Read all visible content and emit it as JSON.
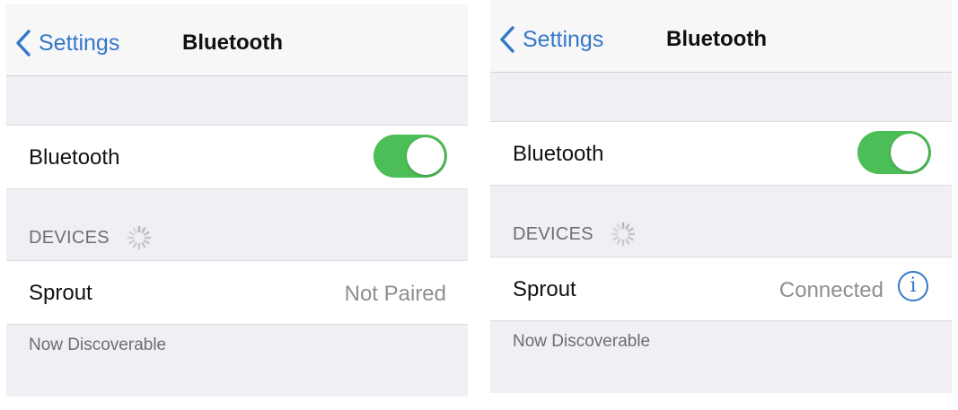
{
  "colors": {
    "accent": "#3478c9",
    "toggle_on": "#4cbe58",
    "background": "#efeff4"
  },
  "panels": [
    {
      "navbar": {
        "back_label": "Settings",
        "title": "Bluetooth"
      },
      "bluetooth": {
        "label": "Bluetooth",
        "enabled": true
      },
      "devices_header": "DEVICES",
      "device": {
        "name": "Sprout",
        "status": "Not Paired"
      },
      "footer": "Now Discoverable"
    },
    {
      "navbar": {
        "back_label": "Settings",
        "title": "Bluetooth"
      },
      "bluetooth": {
        "label": "Bluetooth",
        "enabled": true
      },
      "devices_header": "DEVICES",
      "device": {
        "name": "Sprout",
        "status": "Connected",
        "info_icon": "i"
      },
      "footer": "Now Discoverable"
    }
  ]
}
